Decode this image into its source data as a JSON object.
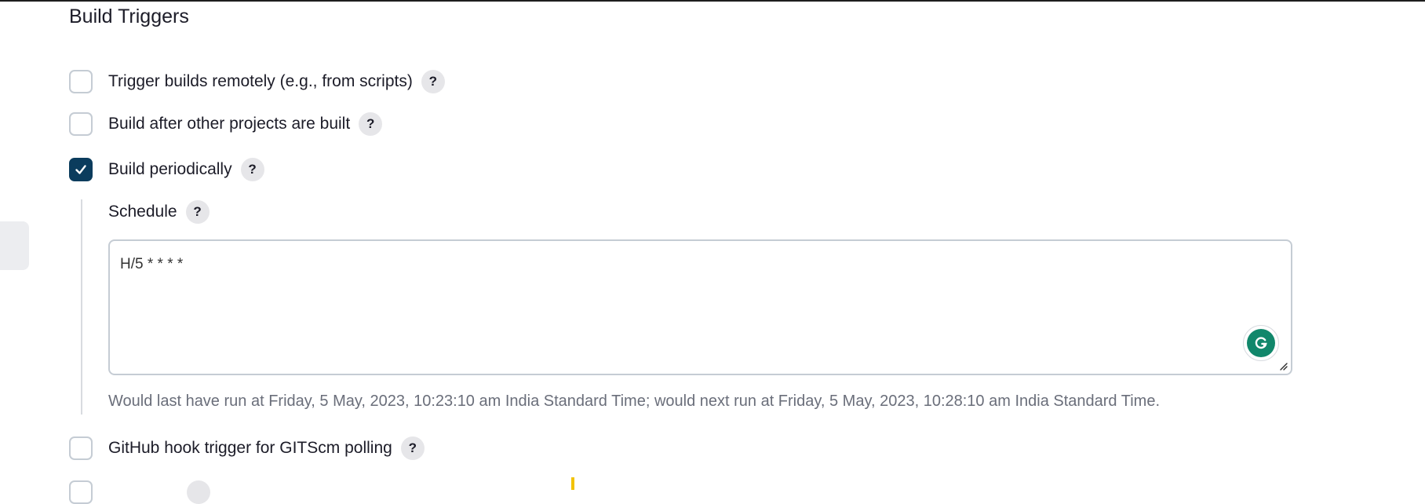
{
  "section": {
    "title": "Build Triggers"
  },
  "options": [
    {
      "label": "Trigger builds remotely (e.g., from scripts)",
      "checked": false,
      "help": "?"
    },
    {
      "label": "Build after other projects are built",
      "checked": false,
      "help": "?"
    },
    {
      "label": "Build periodically",
      "checked": true,
      "help": "?"
    },
    {
      "label": "GitHub hook trigger for GITScm polling",
      "checked": false,
      "help": "?"
    }
  ],
  "schedule": {
    "label": "Schedule",
    "help": "?",
    "value": "H/5 * * * *",
    "hint": "Would last have run at Friday, 5 May, 2023, 10:23:10 am India Standard Time; would next run at Friday, 5 May, 2023, 10:28:10 am India Standard Time."
  },
  "icons": {
    "check": "check-icon",
    "help": "help-icon",
    "grammarly": "grammarly-icon",
    "resize": "resize-handle-icon"
  },
  "colors": {
    "checked_bg": "#0b3c5d",
    "checkbox_border": "#c5ccd4",
    "help_bg": "#e6e6e9",
    "grammarly": "#11876b",
    "hint_text": "#6a6e7a"
  }
}
